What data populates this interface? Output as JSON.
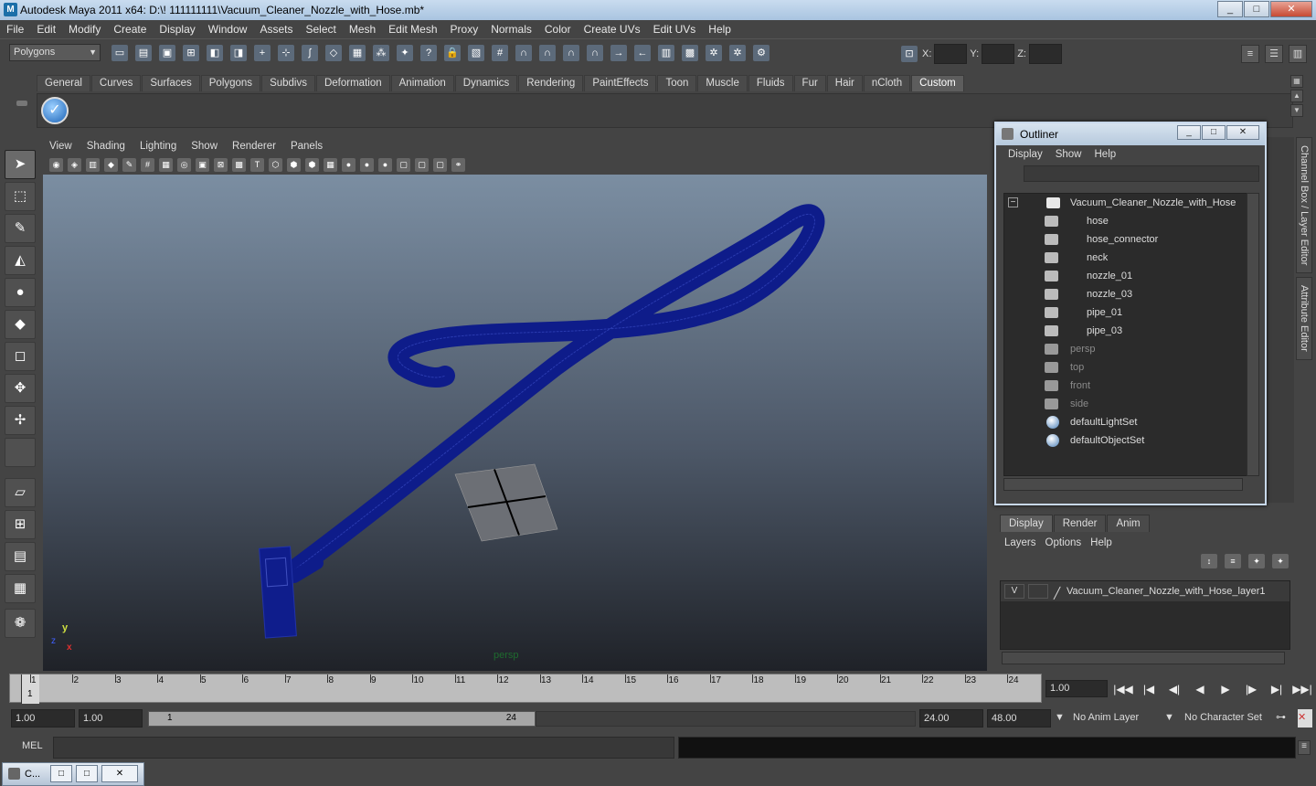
{
  "window": {
    "title": "Autodesk Maya 2011 x64: D:\\! 111111111\\Vacuum_Cleaner_Nozzle_with_Hose.mb*",
    "min": "_",
    "max": "□",
    "close": "✕"
  },
  "menubar": [
    "File",
    "Edit",
    "Modify",
    "Create",
    "Display",
    "Window",
    "Assets",
    "Select",
    "Mesh",
    "Edit Mesh",
    "Proxy",
    "Normals",
    "Color",
    "Create UVs",
    "Edit UVs",
    "Help"
  ],
  "statusline": {
    "mode": "Polygons",
    "x_label": "X:",
    "y_label": "Y:",
    "z_label": "Z:"
  },
  "shelf": {
    "tabs": [
      "General",
      "Curves",
      "Surfaces",
      "Polygons",
      "Subdivs",
      "Deformation",
      "Animation",
      "Dynamics",
      "Rendering",
      "PaintEffects",
      "Toon",
      "Muscle",
      "Fluids",
      "Fur",
      "Hair",
      "nCloth",
      "Custom"
    ],
    "active": "Custom"
  },
  "panel": {
    "menu": [
      "View",
      "Shading",
      "Lighting",
      "Show",
      "Renderer",
      "Panels"
    ],
    "camera_label": "persp"
  },
  "axes": {
    "x": "x",
    "y": "y",
    "z": "z"
  },
  "outliner": {
    "title": "Outliner",
    "menu": [
      "Display",
      "Show",
      "Help"
    ],
    "root": "Vacuum_Cleaner_Nozzle_with_Hose",
    "children": [
      "hose",
      "hose_connector",
      "neck",
      "nozzle_01",
      "nozzle_03",
      "pipe_01",
      "pipe_03"
    ],
    "cameras": [
      "persp",
      "top",
      "front",
      "side"
    ],
    "sets": [
      "defaultLightSet",
      "defaultObjectSet"
    ],
    "collapse": "−"
  },
  "sidetabs": [
    "Channel Box / Layer Editor",
    "Attribute Editor"
  ],
  "layer_editor": {
    "tabs": [
      "Display",
      "Render",
      "Anim"
    ],
    "menu": [
      "Layers",
      "Options",
      "Help"
    ],
    "layer": {
      "visibility": "V",
      "name": "Vacuum_Cleaner_Nozzle_with_Hose_layer1"
    }
  },
  "timeslider": {
    "ticks": [
      "1",
      "2",
      "3",
      "4",
      "5",
      "6",
      "7",
      "8",
      "9",
      "10",
      "11",
      "12",
      "13",
      "14",
      "15",
      "16",
      "17",
      "18",
      "19",
      "20",
      "21",
      "22",
      "23",
      "24"
    ],
    "current": "1",
    "current_field": "1.00"
  },
  "range": {
    "start": "1.00",
    "playback_start": "1.00",
    "bar_start": "1",
    "bar_end": "24",
    "playback_end": "24.00",
    "end": "48.00",
    "anim_layer": "No Anim Layer",
    "character_set": "No Character Set"
  },
  "cmd": {
    "label": "MEL"
  },
  "taskbar": {
    "item": "C..."
  }
}
